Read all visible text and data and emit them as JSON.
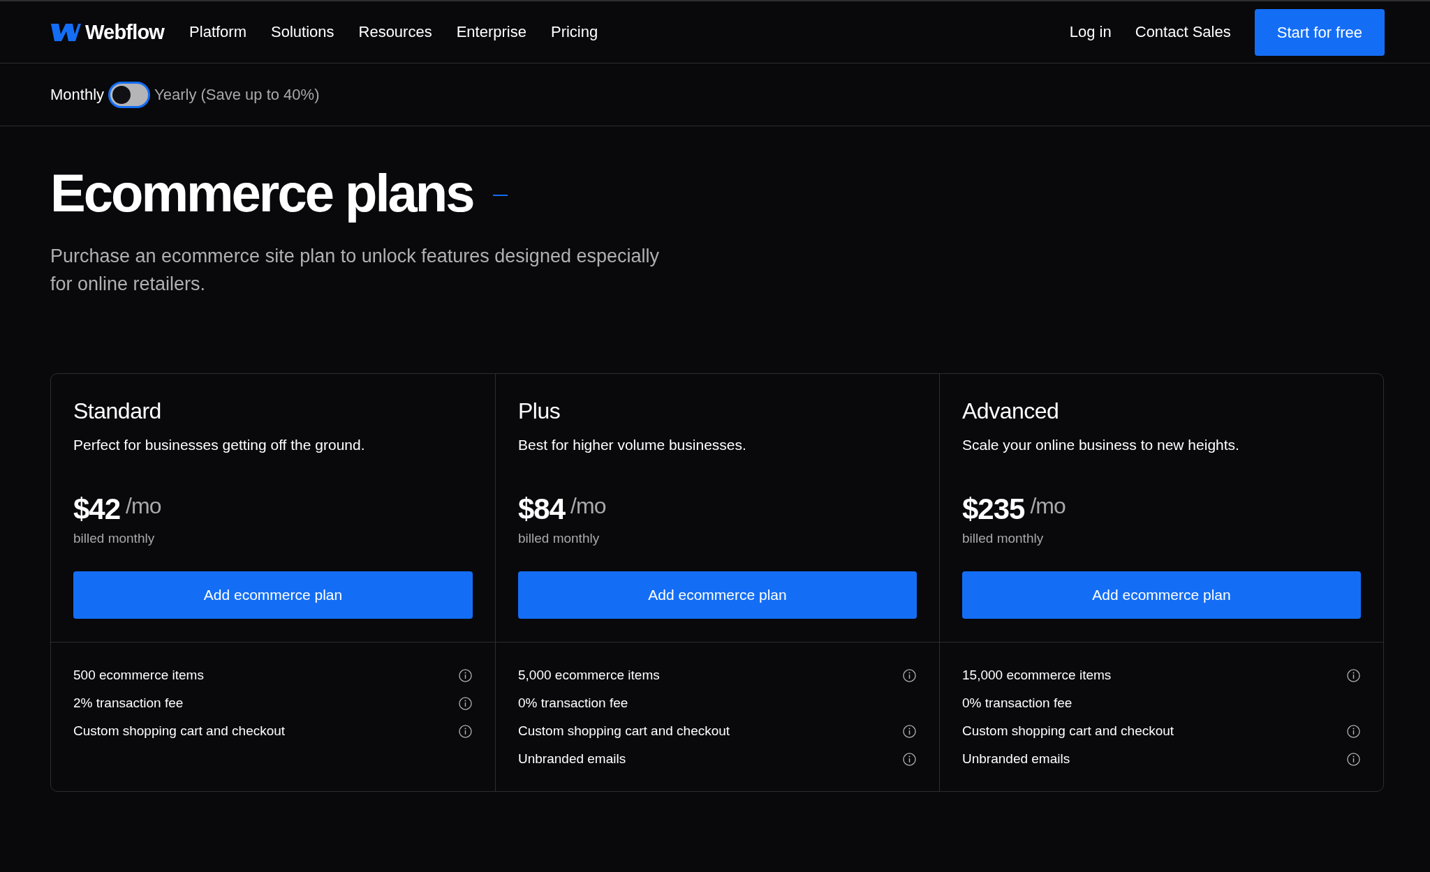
{
  "nav": {
    "logo": {
      "text": "Webflow"
    },
    "links": [
      {
        "label": "Platform"
      },
      {
        "label": "Solutions"
      },
      {
        "label": "Resources"
      },
      {
        "label": "Enterprise"
      },
      {
        "label": "Pricing"
      }
    ],
    "actions": [
      {
        "label": "Log in",
        "kind": "link"
      },
      {
        "label": "Contact Sales",
        "kind": "link"
      },
      {
        "label": "Start for free",
        "kind": "button"
      }
    ]
  },
  "billing_toggle": {
    "left_label": "Monthly",
    "on": false,
    "right_label": "Yearly (Save up to 40%)"
  },
  "hero": {
    "title": "Ecommerce plans",
    "subtitle": "Purchase an ecommerce site plan to unlock features designed especially for online retailers."
  },
  "plans": [
    {
      "name": "Standard",
      "description": "Perfect for businesses getting off the ground.",
      "price": "$42",
      "period": "/mo",
      "billing": "billed monthly",
      "button": "Add ecommerce plan",
      "features": [
        {
          "text": "500 ecommerce items",
          "info": true
        },
        {
          "text": "2% transaction fee",
          "info": true
        },
        {
          "text": "Custom shopping cart and checkout",
          "info": true
        }
      ]
    },
    {
      "name": "Plus",
      "description": "Best for higher volume businesses.",
      "price": "$84",
      "period": "/mo",
      "billing": "billed monthly",
      "button": "Add ecommerce plan",
      "features": [
        {
          "text": "5,000 ecommerce items",
          "info": true
        },
        {
          "text": "0% transaction fee",
          "info": false
        },
        {
          "text": "Custom shopping cart and checkout",
          "info": true
        },
        {
          "text": "Unbranded emails",
          "info": true
        }
      ]
    },
    {
      "name": "Advanced",
      "description": "Scale your online business to new heights.",
      "price": "$235",
      "period": "/mo",
      "billing": "billed monthly",
      "button": "Add ecommerce plan",
      "features": [
        {
          "text": "15,000 ecommerce items",
          "info": true
        },
        {
          "text": "0% transaction fee",
          "info": false
        },
        {
          "text": "Custom shopping cart and checkout",
          "info": true
        },
        {
          "text": "Unbranded emails",
          "info": true
        }
      ]
    }
  ]
}
